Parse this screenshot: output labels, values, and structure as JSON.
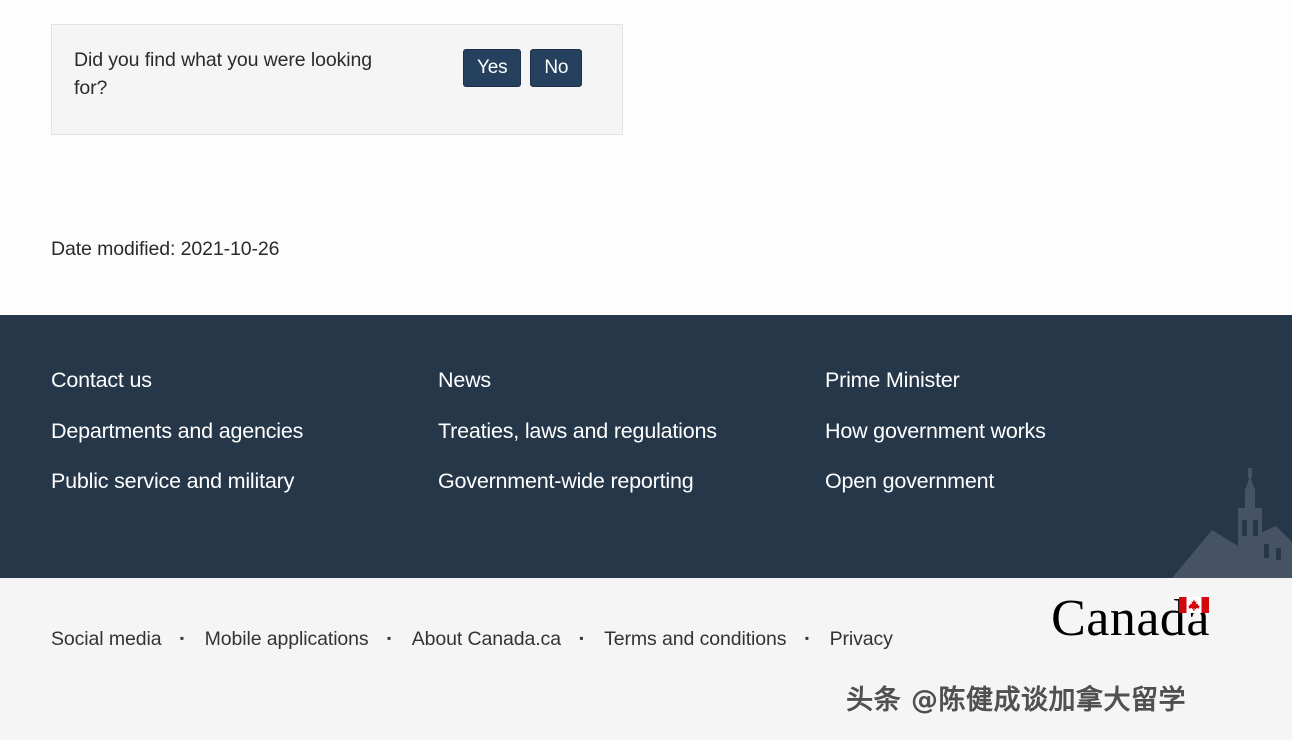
{
  "feedback": {
    "question": "Did you find what you were looking for?",
    "yes_label": "Yes",
    "no_label": "No"
  },
  "page": {
    "date_modified": "Date modified: 2021-10-26"
  },
  "footer": {
    "columns": [
      {
        "links": [
          "Contact us",
          "Departments and agencies",
          "Public service and military"
        ]
      },
      {
        "links": [
          "News",
          "Treaties, laws and regulations",
          "Government-wide reporting"
        ]
      },
      {
        "links": [
          "Prime Minister",
          "How government works",
          "Open government"
        ]
      }
    ],
    "sub_links": [
      "Social media",
      "Mobile applications",
      "About Canada.ca",
      "Terms and conditions",
      "Privacy"
    ],
    "wordmark": "Canada"
  },
  "watermark": {
    "text": "头条 @陈健成谈加拿大留学"
  },
  "colors": {
    "footer_dark": "#26374a",
    "footer_light": "#f5f5f5",
    "button_navy": "#26415e",
    "flag_red": "#d3080c",
    "panel_bg": "#f5f5f5",
    "text_dark": "#333333"
  }
}
